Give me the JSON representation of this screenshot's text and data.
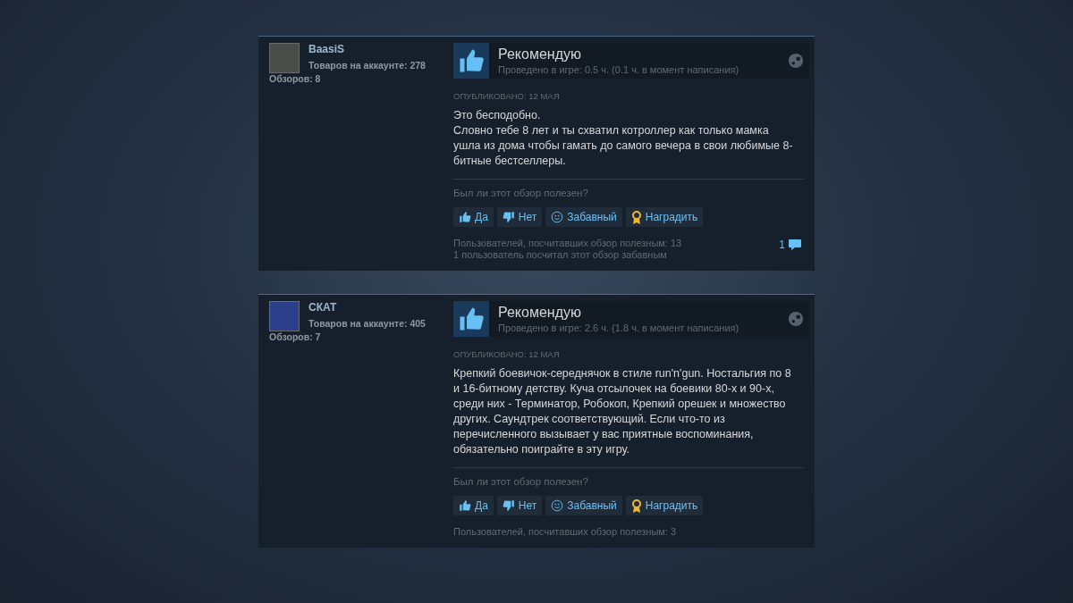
{
  "reviews": [
    {
      "author": {
        "name": "BaasiS",
        "products": "Товаров на аккаунте: 278",
        "reviews_count": "Обзоров: 8"
      },
      "verdict": "Рекомендую",
      "recommended": true,
      "playtime": "Проведено в игре: 0.5 ч. (0.1 ч. в момент написания)",
      "posted": "ОПУБЛИКОВАНО: 12 МАЯ",
      "paragraphs": [
        "Это бесподобно.",
        "Словно тебе 8 лет и ты схватил котроллер как только мамка ушла из дома чтобы гамать до самого вечера в свои любимые 8-битные бестселлеры."
      ],
      "question": "Был ли этот обзор полезен?",
      "buttons": [
        {
          "kind": "yes",
          "label": "Да"
        },
        {
          "kind": "no",
          "label": "Нет"
        },
        {
          "kind": "funny",
          "label": "Забавный"
        },
        {
          "kind": "award",
          "label": "Наградить"
        }
      ],
      "stats": [
        "Пользователей, посчитавших обзор полезным: 13",
        "1 пользователь посчитал этот обзор забавным"
      ],
      "comments": "1"
    },
    {
      "author": {
        "name": "СКАТ",
        "products": "Товаров на аккаунте: 405",
        "reviews_count": "Обзоров: 7"
      },
      "verdict": "Рекомендую",
      "recommended": true,
      "playtime": "Проведено в игре: 2.6 ч. (1.8 ч. в момент написания)",
      "posted": "ОПУБЛИКОВАНО: 12 МАЯ",
      "paragraphs": [
        "Крепкий боевичок-середнячок в стиле run'n'gun. Ностальгия по 8 и 16-битному детству. Куча отсылочек на боевики 80-х и 90-х, среди них - Терминатор, Робокоп, Крепкий орешек и множество других. Саундтрек соответствующий. Если что-то из перечисленного вызывает у вас приятные воспоминания, обязательно поиграйте в эту игру."
      ],
      "question": "Был ли этот обзор полезен?",
      "buttons": [
        {
          "kind": "yes",
          "label": "Да"
        },
        {
          "kind": "no",
          "label": "Нет"
        },
        {
          "kind": "funny",
          "label": "Забавный"
        },
        {
          "kind": "award",
          "label": "Наградить"
        }
      ],
      "stats": [
        "Пользователей, посчитавших обзор полезным: 3"
      ]
    }
  ]
}
